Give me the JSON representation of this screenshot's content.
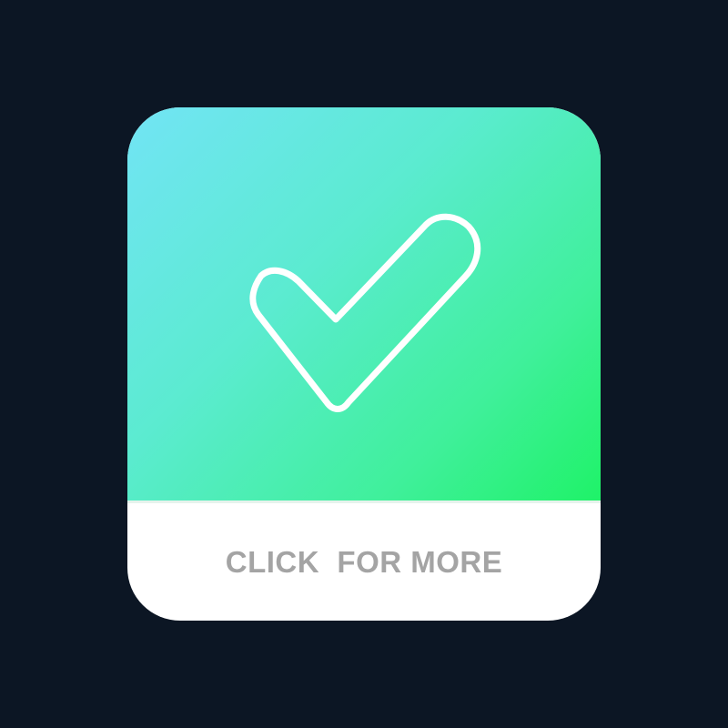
{
  "tile": {
    "icon": "checkmark-outline-icon",
    "gradient_start": "#72e4f5",
    "gradient_end": "#1ff268",
    "background": "#0c1624",
    "cta_color": "#a4a4a4",
    "cta_label": "CLICK  FOR MORE"
  }
}
